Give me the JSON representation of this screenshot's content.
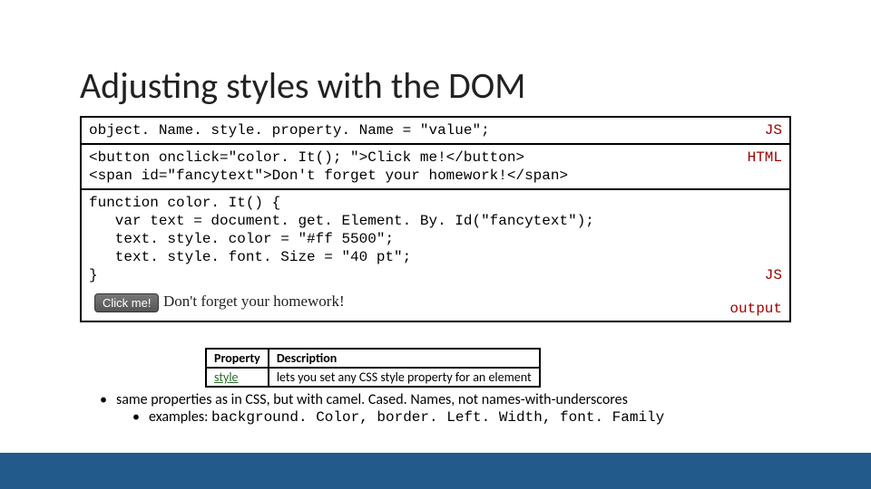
{
  "title": "Adjusting styles with the DOM",
  "panels": {
    "syntax": {
      "code": "object. Name. style. property. Name = \"value\";",
      "badge": "JS"
    },
    "html": {
      "code": "<button onclick=\"color. It(); \">Click me!</button>\n<span id=\"fancytext\">Don't forget your homework!</span>",
      "badge": "HTML"
    },
    "js": {
      "code": "function color. It() {\n   var text = document. get. Element. By. Id(\"fancytext\");\n   text. style. color = \"#ff 5500\";\n   text. style. font. Size = \"40 pt\";\n}",
      "badge": "JS"
    },
    "output": {
      "button_label": "Click me!",
      "text": "Don't forget your homework!",
      "badge": "output"
    }
  },
  "table": {
    "headers": {
      "col1": "Property",
      "col2": "Description"
    },
    "row": {
      "prop": "style",
      "desc": "lets you set any CSS style property for an element"
    }
  },
  "bullets": {
    "b1": "same properties as in CSS, but with camel. Cased. Names, not names-with-underscores",
    "b2_prefix": "examples: ",
    "b2_code": "background. Color, border. Left. Width, font. Family"
  }
}
